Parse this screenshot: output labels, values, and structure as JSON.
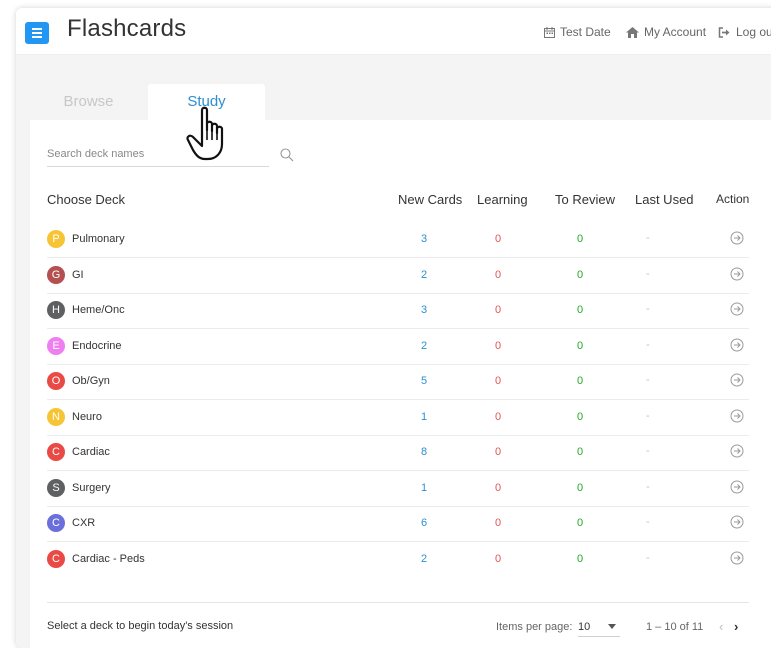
{
  "header": {
    "title": "Flashcards",
    "links": [
      {
        "label": "Test Date",
        "icon": "calendar-icon"
      },
      {
        "label": "My Account",
        "icon": "home-icon"
      },
      {
        "label": "Log out",
        "icon": "logout-icon"
      }
    ]
  },
  "tabs": [
    {
      "label": "Browse",
      "active": false
    },
    {
      "label": "Study",
      "active": true
    }
  ],
  "search": {
    "placeholder": "Search deck names",
    "value": ""
  },
  "table": {
    "columns": [
      "Choose Deck",
      "New Cards",
      "Learning",
      "To Review",
      "Last Used",
      "Action"
    ],
    "rows": [
      {
        "initial": "P",
        "color": "#f7c436",
        "name": "Pulmonary",
        "new": "3",
        "learning": "0",
        "review": "0",
        "last_used": "-"
      },
      {
        "initial": "G",
        "color": "#b4504f",
        "name": "GI",
        "new": "2",
        "learning": "0",
        "review": "0",
        "last_used": "-"
      },
      {
        "initial": "H",
        "color": "#5f6061",
        "name": "Heme/Onc",
        "new": "3",
        "learning": "0",
        "review": "0",
        "last_used": "-"
      },
      {
        "initial": "E",
        "color": "#ef7ff0",
        "name": "Endocrine",
        "new": "2",
        "learning": "0",
        "review": "0",
        "last_used": "-"
      },
      {
        "initial": "O",
        "color": "#e94a45",
        "name": "Ob/Gyn",
        "new": "5",
        "learning": "0",
        "review": "0",
        "last_used": "-"
      },
      {
        "initial": "N",
        "color": "#f7c436",
        "name": "Neuro",
        "new": "1",
        "learning": "0",
        "review": "0",
        "last_used": "-"
      },
      {
        "initial": "C",
        "color": "#e94a45",
        "name": "Cardiac",
        "new": "8",
        "learning": "0",
        "review": "0",
        "last_used": "-"
      },
      {
        "initial": "S",
        "color": "#5f6061",
        "name": "Surgery",
        "new": "1",
        "learning": "0",
        "review": "0",
        "last_used": "-"
      },
      {
        "initial": "C",
        "color": "#6b6fdc",
        "name": "CXR",
        "new": "6",
        "learning": "0",
        "review": "0",
        "last_used": "-"
      },
      {
        "initial": "C",
        "color": "#e94a45",
        "name": "Cardiac - Peds",
        "new": "2",
        "learning": "0",
        "review": "0",
        "last_used": "-"
      }
    ]
  },
  "footer": {
    "message": "Select a deck to begin today's session",
    "items_per_page_label": "Items per page:",
    "items_per_page": "10",
    "range": "1 – 10 of 11",
    "prev": "‹",
    "next": "›"
  },
  "colors": {
    "accent": "#2196f3",
    "new_cards": "#2d8fd0",
    "learning": "#e05555",
    "to_review": "#24a824"
  }
}
